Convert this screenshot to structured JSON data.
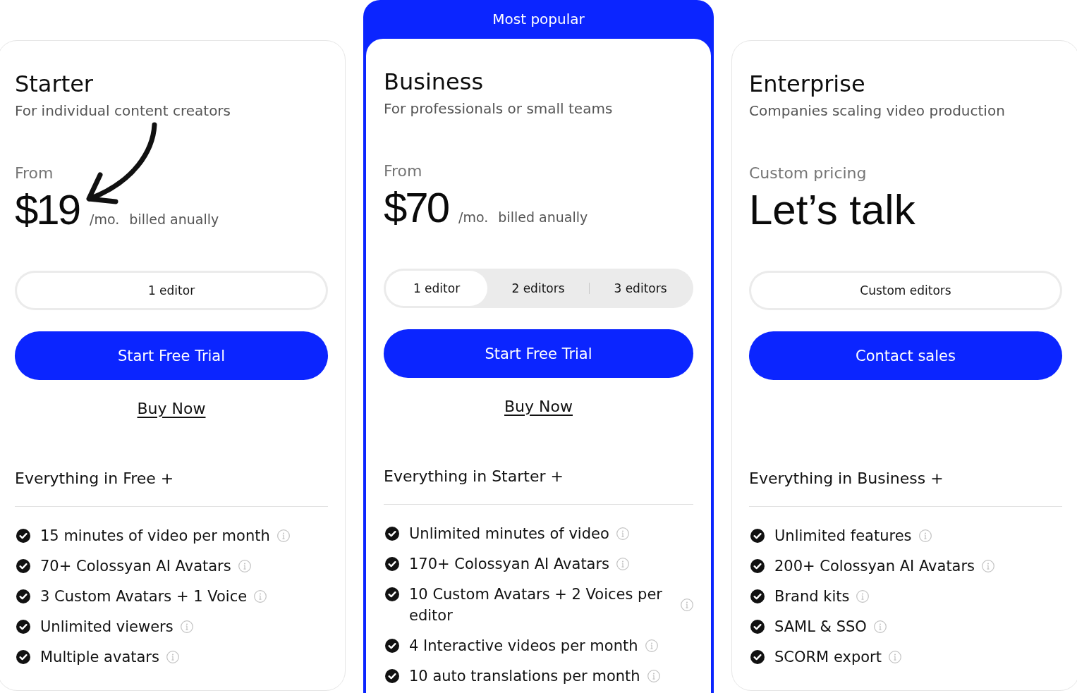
{
  "plans": [
    {
      "name": "Starter",
      "tagline": "For individual content creators",
      "price_label": "From",
      "price": "$19",
      "period": "/mo.",
      "billing": "billed anually",
      "arrow": true,
      "editor_options": [
        {
          "label": "1 editor",
          "selected": true
        }
      ],
      "primary_button": "Start Free Trial",
      "secondary_link": "Buy Now",
      "features_heading": "Everything in Free +",
      "features": [
        "15 minutes of video per month",
        "70+ Colossyan AI Avatars",
        "3 Custom Avatars + 1 Voice",
        "Unlimited viewers",
        "Multiple avatars"
      ]
    },
    {
      "badge": "Most popular",
      "name": "Business",
      "tagline": "For professionals or small teams",
      "price_label": "From",
      "price": "$70",
      "period": "/mo.",
      "billing": "billed anually",
      "arrow": false,
      "editor_options": [
        {
          "label": "1 editor",
          "selected": true
        },
        {
          "label": "2 editors",
          "selected": false
        },
        {
          "label": "3 editors",
          "selected": false
        }
      ],
      "primary_button": "Start Free Trial",
      "secondary_link": "Buy Now",
      "features_heading": "Everything in Starter +",
      "features": [
        "Unlimited minutes of video",
        "170+ Colossyan AI Avatars",
        "10 Custom Avatars + 2 Voices per editor",
        "4 Interactive videos per month",
        "10 auto translations per month"
      ]
    },
    {
      "name": "Enterprise",
      "tagline": "Companies scaling video production",
      "price_label": "Custom pricing",
      "price": "Let’s talk",
      "arrow": false,
      "editor_options": [
        {
          "label": "Custom editors",
          "selected": true
        }
      ],
      "primary_button": "Contact sales",
      "features_heading": "Everything in Business +",
      "features": [
        "Unlimited features",
        "200+ Colossyan AI Avatars",
        "Brand kits",
        "SAML & SSO",
        "SCORM export"
      ]
    }
  ]
}
